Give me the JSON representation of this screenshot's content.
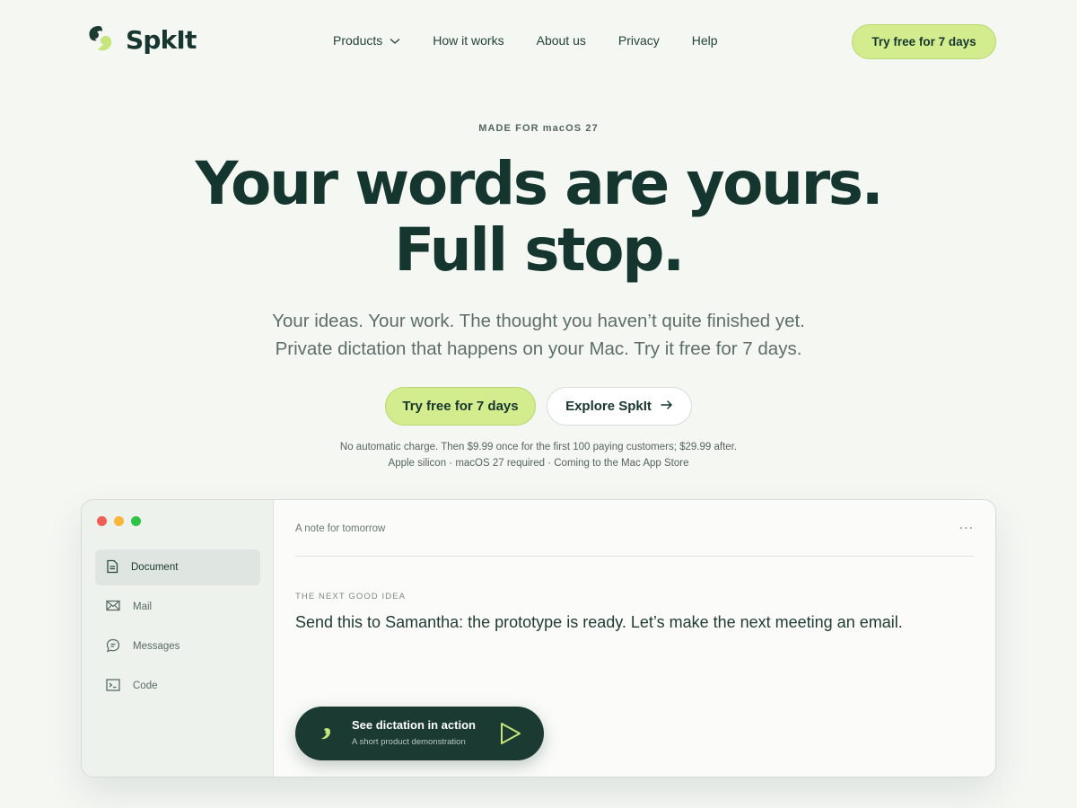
{
  "nav": {
    "logo_text": "SpkIt",
    "links": [
      {
        "label": "Products",
        "has_dropdown": true
      },
      {
        "label": "How it works"
      },
      {
        "label": "About us"
      },
      {
        "label": "Privacy"
      },
      {
        "label": "Help"
      }
    ],
    "cta_label": "Try free for 7 days"
  },
  "hero": {
    "eyebrow": "MADE FOR macOS 27",
    "headline_line1": "Your words are yours.",
    "headline_line2": "Full stop.",
    "subhead_line1": "Your ideas. Your work. The thought you haven’t quite finished yet.",
    "subhead_line2": "Private dictation that happens on your Mac. Try it free for 7 days.",
    "primary_button": "Try free for 7 days",
    "secondary_button": "Explore SpkIt",
    "fineprint_line1": "No automatic charge. Then $9.99 once for the first 100 paying customers; $29.99 after.",
    "fineprint_line2": "Apple silicon · macOS 27 required · Coming to the Mac App Store"
  },
  "app_window": {
    "sidebar": [
      {
        "label": "Document",
        "icon": "document-icon",
        "active": true
      },
      {
        "label": "Mail",
        "icon": "mail-icon",
        "active": false
      },
      {
        "label": "Messages",
        "icon": "message-bubble-icon",
        "active": false
      },
      {
        "label": "Code",
        "icon": "terminal-icon",
        "active": false
      }
    ],
    "doc_title": "A note for tomorrow",
    "more_label": "···",
    "section_label": "THE NEXT GOOD IDEA",
    "body_text": "Send this to Samantha: the prototype is ready. Let’s make the next meeting an email.",
    "demo": {
      "title": "See dictation in action",
      "subtitle": "A short product demonstration"
    }
  },
  "colors": {
    "background": "#f5f7f3",
    "brand_dark": "#17362f",
    "accent_lime": "#d3ec8d",
    "demo_pill": "#1a3a32"
  }
}
